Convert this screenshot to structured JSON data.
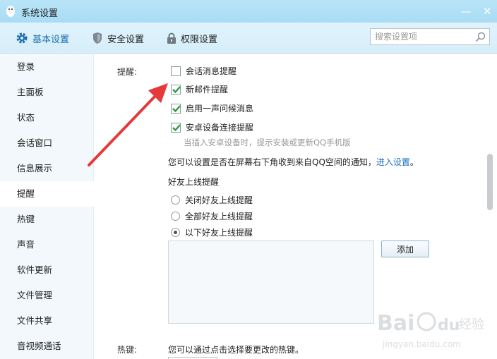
{
  "window": {
    "title": "系统设置",
    "minimize_glyph": "—",
    "close_glyph": "✕"
  },
  "toolbar": {
    "tabs": [
      {
        "label": "基本设置",
        "icon": "gear-icon",
        "active": true
      },
      {
        "label": "安全设置",
        "icon": "shield-icon",
        "active": false
      },
      {
        "label": "权限设置",
        "icon": "lock-icon",
        "active": false
      }
    ],
    "search_placeholder": "搜索设置项"
  },
  "sidebar": {
    "items": [
      "登录",
      "主面板",
      "状态",
      "会话窗口",
      "信息展示",
      "提醒",
      "热键",
      "声音",
      "软件更新",
      "文件管理",
      "文件共享",
      "音视频通话"
    ],
    "active_index": 5
  },
  "reminder": {
    "section_label": "提醒:",
    "options": [
      {
        "label": "会话消息提醒",
        "checked": false
      },
      {
        "label": "新邮件提醒",
        "checked": true
      },
      {
        "label": "启用一声问候消息",
        "checked": true
      },
      {
        "label": "安卓设备连接提醒",
        "checked": true
      }
    ],
    "android_hint": "当插入安卓设备时，提示安装或更新QQ手机版",
    "qzone_text": "您可以设置是否在屏幕右下角收到来自QQ空间的通知，",
    "qzone_link": "进入设置",
    "qzone_end": "。",
    "friend_online_title": "好友上线提醒",
    "friend_options": [
      {
        "label": "关闭好友上线提醒",
        "checked": false
      },
      {
        "label": "全部好友上线提醒",
        "checked": false
      },
      {
        "label": "以下好友上线提醒",
        "checked": true
      }
    ],
    "add_button": "添加"
  },
  "hotkey": {
    "section_label": "热键:",
    "description": "您可以通过点击选择要更改的热键。"
  },
  "watermark": {
    "brand": "Bai",
    "brand2": "du",
    "jingyan": "经验",
    "url": "jingyan.baidu.com"
  },
  "colors": {
    "accent": "#1d6fb0",
    "check_green": "#2c9c3c",
    "arrow_red": "#e5393b"
  }
}
